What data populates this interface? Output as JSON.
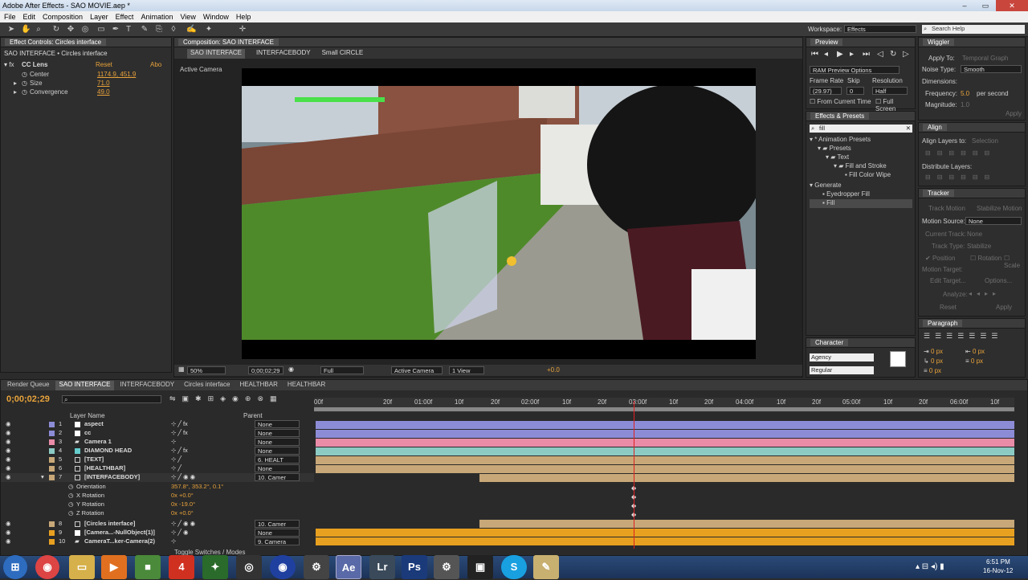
{
  "window": {
    "title": "Adobe After Effects - SAO MOVIE.aep *"
  },
  "menu": [
    "File",
    "Edit",
    "Composition",
    "Layer",
    "Effect",
    "Animation",
    "View",
    "Window",
    "Help"
  ],
  "toolbar": {
    "workspace_label": "Workspace:",
    "workspace_value": "Effects",
    "search_placeholder": "Search Help"
  },
  "effect_controls": {
    "tab": "Effect Controls: Circles interface",
    "path": "SAO INTERFACE • Circles interface",
    "effect_name": "CC Lens",
    "reset": "Reset",
    "about": "Abo",
    "props": [
      {
        "name": "Center",
        "value": "1174.9, 451.9"
      },
      {
        "name": "Size",
        "value": "71.0"
      },
      {
        "name": "Convergence",
        "value": "49.0"
      }
    ]
  },
  "composition": {
    "tab": "Composition: SAO INTERFACE",
    "crumbs": [
      "SAO INTERFACE",
      "INTERFACEBODY",
      "Small CIRCLE"
    ],
    "camera_label": "Active Camera",
    "footer": {
      "zoom": "50%",
      "timecode": "0;00;02;29",
      "resolution": "Full",
      "camera": "Active Camera",
      "view": "1 View",
      "exposure": "+0.0"
    }
  },
  "preview": {
    "title": "Preview",
    "ram": "RAM Preview Options",
    "frame_rate_label": "Frame Rate",
    "skip_label": "Skip",
    "resolution_label": "Resolution",
    "frame_rate": "(29.97)",
    "skip": "0",
    "resolution": "Half",
    "from_current": "From Current Time",
    "full_screen": "Full Screen"
  },
  "effects_presets": {
    "title": "Effects & Presets",
    "search": "fill",
    "tree": [
      {
        "label": "* Animation Presets",
        "indent": 0
      },
      {
        "label": "Presets",
        "indent": 1
      },
      {
        "label": "Text",
        "indent": 2
      },
      {
        "label": "Fill and Stroke",
        "indent": 3
      },
      {
        "label": "Fill Color Wipe",
        "indent": 4
      },
      {
        "label": "Generate",
        "indent": 0
      },
      {
        "label": "Eyedropper Fill",
        "indent": 1
      },
      {
        "label": "Fill",
        "indent": 1
      }
    ]
  },
  "character": {
    "title": "Character",
    "font": "Agency",
    "style": "Regular"
  },
  "wiggler": {
    "title": "Wiggler",
    "apply_to": "Apply To:",
    "apply_to_value": "Temporal Graph",
    "noise_type": "Noise Type:",
    "noise_value": "Smooth",
    "dimensions": "Dimensions:",
    "frequency": "Frequency:",
    "frequency_value": "5.0",
    "per_second": "per second",
    "magnitude": "Magnitude:",
    "magnitude_value": "1.0",
    "apply": "Apply"
  },
  "align": {
    "title": "Align",
    "align_to": "Align Layers to:",
    "align_to_value": "Selection",
    "distribute": "Distribute Layers:"
  },
  "tracker": {
    "title": "Tracker",
    "track_motion": "Track Motion",
    "stabilize": "Stabilize Motion",
    "motion_source": "Motion Source:",
    "motion_source_value": "None",
    "current_track": "Current Track:",
    "current_track_value": "None",
    "track_type": "Track Type:",
    "track_type_value": "Stabilize",
    "position": "Position",
    "rotation": "Rotation",
    "scale": "Scale",
    "motion_target": "Motion Target:",
    "edit_target": "Edit Target...",
    "options": "Options...",
    "analyze": "Analyze:",
    "reset": "Reset",
    "apply": "Apply"
  },
  "paragraph": {
    "title": "Paragraph",
    "px1": "0 px",
    "px2": "0 px",
    "px3": "0 px",
    "px4": "0 px",
    "px5": "0 px"
  },
  "timeline": {
    "tabs": [
      "Render Queue",
      "SAO INTERFACE",
      "INTERFACEBODY",
      "Circles interface",
      "HEALTHBAR",
      "HEALTHBAR"
    ],
    "timecode": "0;00;02;29",
    "col_layer": "Layer Name",
    "col_parent": "Parent",
    "ruler": [
      "00f",
      "20f",
      "01:00f",
      "10f",
      "20f",
      "02:00f",
      "10f",
      "20f",
      "03:00f",
      "10f",
      "20f",
      "04:00f",
      "10f",
      "20f",
      "05:00f",
      "10f",
      "20f",
      "06:00f",
      "10f"
    ],
    "layers": [
      {
        "num": "1",
        "name": "aspect",
        "parent": "None",
        "color": "#8c8cd6"
      },
      {
        "num": "2",
        "name": "cc",
        "parent": "None",
        "color": "#8c8cd6"
      },
      {
        "num": "3",
        "name": "Camera 1",
        "parent": "None",
        "color": "#e88ca8"
      },
      {
        "num": "4",
        "name": "DIAMOND HEAD",
        "parent": "None",
        "color": "#8ccac4"
      },
      {
        "num": "5",
        "name": "[TEXT]",
        "parent": "6. HEALT",
        "color": "#c8a878"
      },
      {
        "num": "6",
        "name": "[HEALTHBAR]",
        "parent": "None",
        "color": "#c8a878"
      },
      {
        "num": "7",
        "name": "[INTERFACEBODY]",
        "parent": "10. Camer",
        "color": "#c8a878"
      }
    ],
    "props": [
      {
        "name": "Orientation",
        "value": "357.8°, 353.2°, 0.1°"
      },
      {
        "name": "X Rotation",
        "value": "0x +0.0°"
      },
      {
        "name": "Y Rotation",
        "value": "0x -19.0°"
      },
      {
        "name": "Z Rotation",
        "value": "0x +0.0°"
      }
    ],
    "layers2": [
      {
        "num": "8",
        "name": "[Circles interface]",
        "parent": "10. Camer",
        "color": "#c8a878"
      },
      {
        "num": "9",
        "name": "[Camera...-NullObject(1)]",
        "parent": "None",
        "color": "#e8a020"
      },
      {
        "num": "10",
        "name": "CameraT...ker-Camera(2)",
        "parent": "9. Camera",
        "color": "#e8a020"
      }
    ],
    "toggle": "Toggle Switches / Modes"
  },
  "taskbar": {
    "time": "6:51 PM",
    "date": "16-Nov-12"
  }
}
